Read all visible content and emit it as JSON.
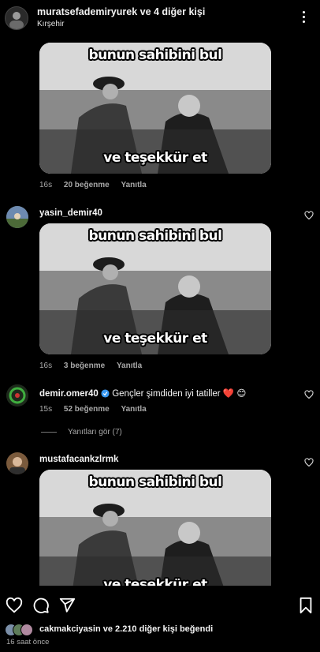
{
  "header": {
    "title": "muratsefademiryurek ve 4 diğer kişi",
    "location": "Kırşehir"
  },
  "meme": {
    "top_caption": "bunun sahibini bul",
    "bottom_caption": "ve teşekkür et"
  },
  "comments": [
    {
      "time": "16s",
      "likes": "20 beğenme",
      "reply": "Yanıtla"
    },
    {
      "username": "yasin_demir40",
      "time": "16s",
      "likes": "3 beğenme",
      "reply": "Yanıtla"
    },
    {
      "username": "demir.omer40",
      "text": "Gençler şimdiden iyi tatiller ❤️ 😊",
      "time": "15s",
      "likes": "52 beğenme",
      "reply": "Yanıtla",
      "view_replies": "Yanıtları gör (7)"
    },
    {
      "username": "mustafacankzlrmk"
    }
  ],
  "footer": {
    "liked_by": "cakmakciyasin ve 2.210 diğer kişi beğendi",
    "time_ago": "16 saat önce"
  },
  "icons": [
    "more-icon",
    "heart-icon",
    "comment-icon",
    "share-icon",
    "bookmark-icon",
    "verified-icon"
  ],
  "colors": {
    "background": "#000000",
    "text": "#f5f5f5",
    "muted": "#a8a8a8",
    "verified": "#3797f0"
  }
}
